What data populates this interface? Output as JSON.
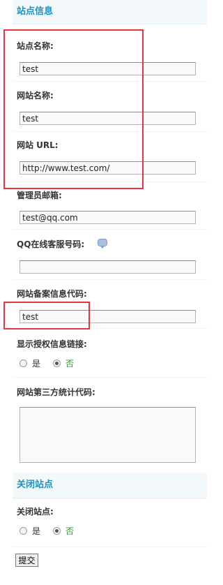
{
  "site_info": {
    "title": "站点信息",
    "fields": {
      "site_name": {
        "label": "站点名称:",
        "value": "test"
      },
      "website_name": {
        "label": "网站名称:",
        "value": "test"
      },
      "website_url": {
        "label": "网站 URL:",
        "value": "http://www.test.com/"
      },
      "admin_email": {
        "label": "管理员邮箱:",
        "value": "test@qq.com"
      },
      "qq_service": {
        "label": "QQ在线客服号码:",
        "value": ""
      },
      "icp_code": {
        "label": "网站备案信息代码:",
        "value": "test"
      },
      "show_license_link": {
        "label": "显示授权信息链接:",
        "options": [
          "是",
          "否"
        ],
        "selected": "否"
      },
      "stats_code": {
        "label": "网站第三方统计代码:",
        "value": ""
      }
    }
  },
  "close_site": {
    "title": "关闭站点",
    "fields": {
      "close_site": {
        "label": "关闭站点:",
        "options": [
          "是",
          "否"
        ],
        "selected": "否"
      }
    }
  },
  "submit_label": "提交",
  "colors": {
    "section_title": "#1f8fc4",
    "highlight_box": "#e8353b",
    "selected_option_text": "#2a9a2a"
  }
}
